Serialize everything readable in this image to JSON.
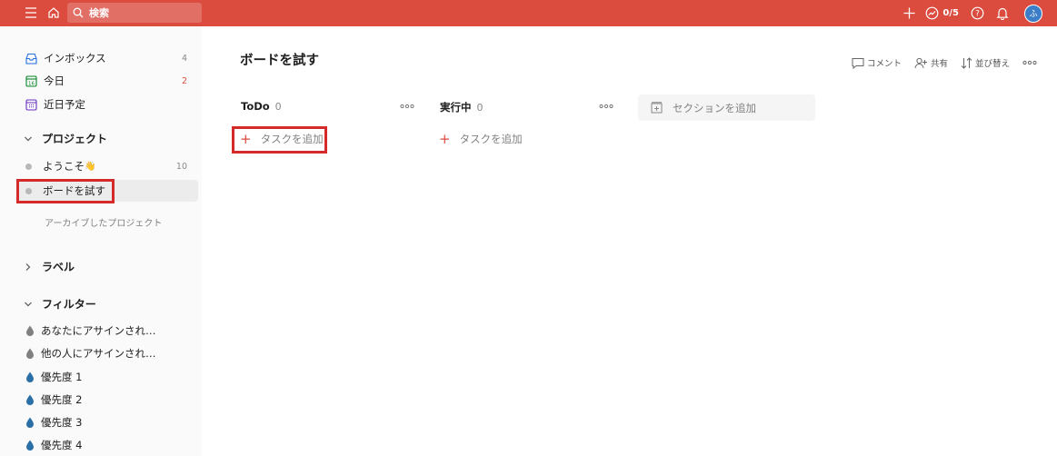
{
  "topbar": {
    "search_placeholder": "検索",
    "karma": "0/5",
    "avatar_initial": "ふ"
  },
  "sidebar": {
    "items": [
      {
        "label": "インボックス",
        "count": "4"
      },
      {
        "label": "今日",
        "count": "2"
      },
      {
        "label": "近日予定",
        "count": ""
      }
    ],
    "projects_header": "プロジェクト",
    "projects": [
      {
        "label": "ようこそ",
        "emoji": "👋",
        "count": "10"
      },
      {
        "label": "ボードを試す",
        "count": ""
      }
    ],
    "archived_label": "アーカイブしたプロジェクト",
    "labels_header": "ラベル",
    "filters_header": "フィルター",
    "filters": [
      {
        "label": "あなたにアサインされ…",
        "color": "#808080"
      },
      {
        "label": "他の人にアサインされ…",
        "color": "#808080"
      },
      {
        "label": "優先度 1",
        "color": "#2a6fa6"
      },
      {
        "label": "優先度 2",
        "color": "#2a6fa6"
      },
      {
        "label": "優先度 3",
        "color": "#2a6fa6"
      },
      {
        "label": "優先度 4",
        "color": "#2a6fa6"
      }
    ]
  },
  "main": {
    "title": "ボードを試す",
    "actions": {
      "comment": "コメント",
      "share": "共有",
      "sort": "並び替え"
    },
    "columns": [
      {
        "name": "ToDo",
        "count": "0",
        "add_task": "タスクを追加"
      },
      {
        "name": "実行中",
        "count": "0",
        "add_task": "タスクを追加"
      }
    ],
    "add_section": "セクションを追加"
  },
  "colors": {
    "brand": "#db4c3f",
    "highlight": "#d42a2a"
  }
}
